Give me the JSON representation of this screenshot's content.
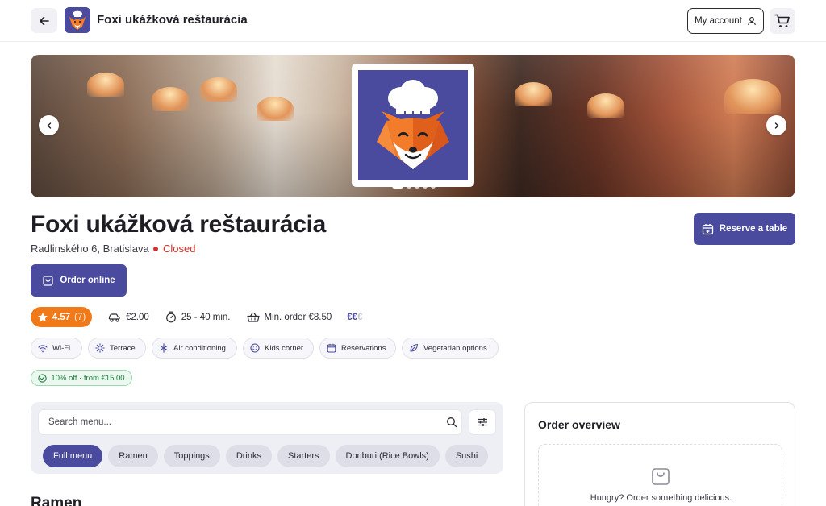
{
  "header": {
    "brand_name": "Foxi ukážková reštaurácia",
    "account_label": "My account"
  },
  "restaurant": {
    "name": "Foxi ukážková reštaurácia",
    "address": "Radlinského 6, Bratislava",
    "status": "Closed",
    "reserve_label": "Reserve a table",
    "order_online_label": "Order online"
  },
  "hero": {
    "slide_count": 5,
    "active_slide": 1
  },
  "meta": {
    "rating": "4.57",
    "rating_count": "(7)",
    "delivery_fee": "€2.00",
    "delivery_time": "25 - 40 min.",
    "min_order": "Min. order €8.50",
    "price_level_active": "€€",
    "price_level_dim": "€"
  },
  "amenities": [
    {
      "label": "Wi-Fi",
      "icon": "wifi-icon"
    },
    {
      "label": "Terrace",
      "icon": "sun-icon"
    },
    {
      "label": "Air conditioning",
      "icon": "snowflake-icon"
    },
    {
      "label": "Kids corner",
      "icon": "smile-icon"
    },
    {
      "label": "Reservations",
      "icon": "calendar-icon"
    },
    {
      "label": "Vegetarian options",
      "icon": "leaf-icon"
    }
  ],
  "discount": {
    "label": "10% off · from €15.00"
  },
  "menu": {
    "search_placeholder": "Search menu...",
    "categories": [
      {
        "label": "Full menu",
        "active": true
      },
      {
        "label": "Ramen",
        "active": false
      },
      {
        "label": "Toppings",
        "active": false
      },
      {
        "label": "Drinks",
        "active": false
      },
      {
        "label": "Starters",
        "active": false
      },
      {
        "label": "Donburi (Rice Bowls)",
        "active": false
      },
      {
        "label": "Sushi",
        "active": false
      }
    ],
    "section_heading": "Ramen"
  },
  "order_overview": {
    "title": "Order overview",
    "empty_text": "Hungry? Order something delicious."
  },
  "colors": {
    "brand": "#4a4a9e",
    "rating": "#f07a1a",
    "closed": "#d1332f",
    "discount": "#1f7a3d"
  }
}
